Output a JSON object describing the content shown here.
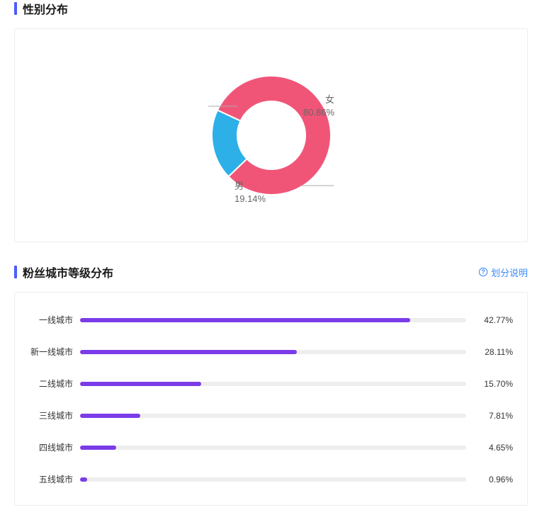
{
  "sections": {
    "gender": {
      "title": "性别分布"
    },
    "city": {
      "title": "粉丝城市等级分布",
      "help_label": "划分说明"
    }
  },
  "colors": {
    "accent_bar": "#4e5bff",
    "donut_female": "#f05577",
    "donut_male": "#2db0e8",
    "bar_fill": "#7a3ce8",
    "bar_track": "#eeeeee",
    "link": "#3d8bfd"
  },
  "chart_data": [
    {
      "type": "pie",
      "id": "gender_donut",
      "title": "性别分布",
      "series": [
        {
          "name": "女",
          "value": 80.86,
          "label": "80.86%",
          "color": "#f05577"
        },
        {
          "name": "男",
          "value": 19.14,
          "label": "19.14%",
          "color": "#2db0e8"
        }
      ],
      "donut": true
    },
    {
      "type": "bar",
      "id": "city_bars",
      "title": "粉丝城市等级分布",
      "orientation": "horizontal",
      "xlim": [
        0,
        50
      ],
      "categories": [
        "一线城市",
        "新一线城市",
        "二线城市",
        "三线城市",
        "四线城市",
        "五线城市"
      ],
      "values": [
        42.77,
        28.11,
        15.7,
        7.81,
        4.65,
        0.96
      ],
      "value_labels": [
        "42.77%",
        "28.11%",
        "15.70%",
        "7.81%",
        "4.65%",
        "0.96%"
      ],
      "color": "#7a3ce8"
    }
  ]
}
